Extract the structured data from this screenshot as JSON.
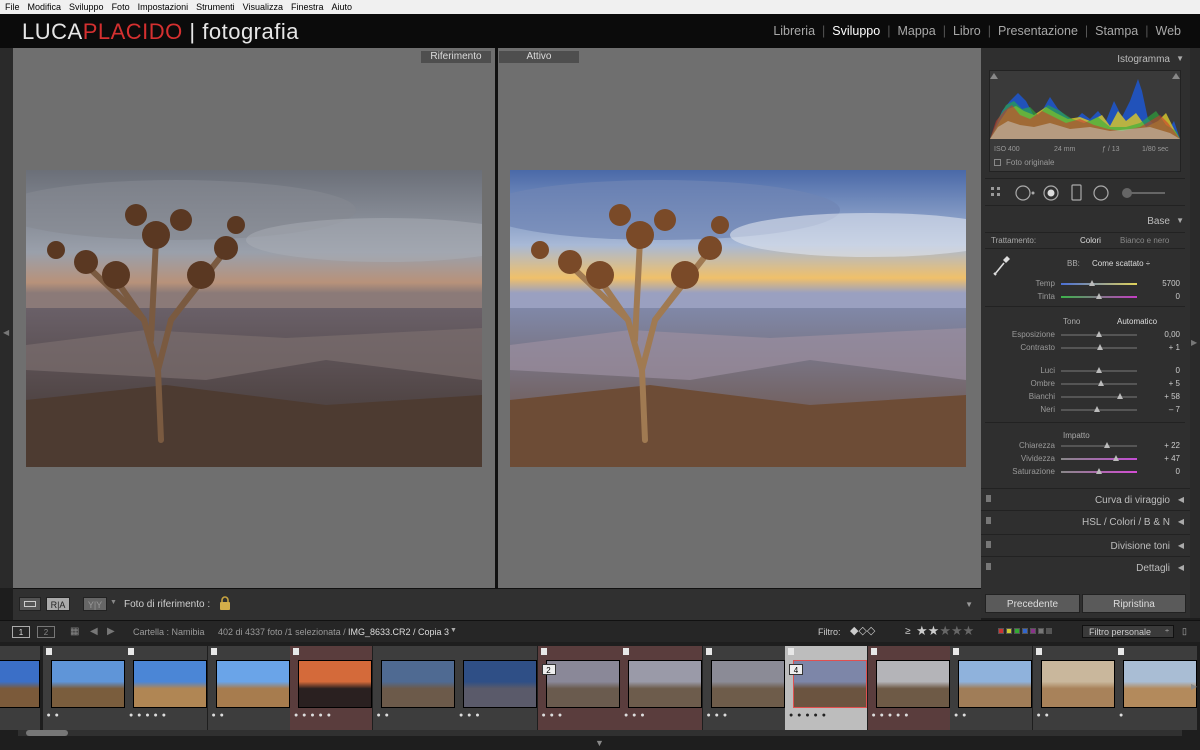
{
  "menu": [
    "File",
    "Modifica",
    "Sviluppo",
    "Foto",
    "Impostazioni",
    "Strumenti",
    "Visualizza",
    "Finestra",
    "Aiuto"
  ],
  "logo": {
    "part1": "LUCA",
    "part2": "PLACIDO",
    "sep": "|",
    "part3": "fotografia"
  },
  "modules": [
    {
      "label": "Libreria",
      "active": false
    },
    {
      "label": "Sviluppo",
      "active": true
    },
    {
      "label": "Mappa",
      "active": false
    },
    {
      "label": "Libro",
      "active": false
    },
    {
      "label": "Presentazione",
      "active": false
    },
    {
      "label": "Stampa",
      "active": false
    },
    {
      "label": "Web",
      "active": false
    }
  ],
  "compare": {
    "ref_label": "Riferimento",
    "active_label": "Attivo"
  },
  "toolbar": {
    "ref_photo_label": "Foto di riferimento :",
    "btn_view1": "R|A",
    "btn_view2": "Y|Y"
  },
  "panel": {
    "histogram_title": "Istogramma",
    "exif": {
      "iso": "ISO 400",
      "focal": "24 mm",
      "aperture": "ƒ / 13",
      "shutter": "1/80 sec"
    },
    "original_label": "Foto originale",
    "base_title": "Base",
    "treatment_label": "Trattamento:",
    "treatment_color": "Colori",
    "treatment_bw": "Bianco e nero",
    "wb_label": "BB:",
    "wb_value": "Come scattato ÷",
    "tone_label": "Tono",
    "auto_label": "Automatico",
    "presence_label": "Impatto",
    "sliders": [
      {
        "label": "Temp",
        "value": "5700",
        "pos": 0.41
      },
      {
        "label": "Tinta",
        "value": "0",
        "pos": 0.5
      },
      {
        "label": "Esposizione",
        "value": "0,00",
        "pos": 0.5
      },
      {
        "label": "Contrasto",
        "value": "+ 1",
        "pos": 0.51
      },
      {
        "label": "Luci",
        "value": "0",
        "pos": 0.5
      },
      {
        "label": "Ombre",
        "value": "+ 5",
        "pos": 0.53
      },
      {
        "label": "Bianchi",
        "value": "+ 58",
        "pos": 0.78
      },
      {
        "label": "Neri",
        "value": "– 7",
        "pos": 0.47
      },
      {
        "label": "Chiarezza",
        "value": "+ 22",
        "pos": 0.61
      },
      {
        "label": "Vividezza",
        "value": "+ 47",
        "pos": 0.72
      },
      {
        "label": "Saturazione",
        "value": "0",
        "pos": 0.5
      }
    ],
    "collapsed_sections": [
      "Curva di viraggio",
      "HSL  /  Colori  /  B & N",
      "Divisione toni",
      "Dettagli"
    ],
    "prev_button": "Precedente",
    "reset_button": "Ripristina"
  },
  "filmstrip_bar": {
    "page1": "1",
    "page2": "2",
    "folder": "Cartella : Namibia",
    "count": "402 di 4337 foto /1 selezionata /",
    "filename": "IMG_8633.CR2 / Copia 3",
    "filter_label": "Filtro:",
    "rating_op": "≥",
    "filter_preset": "Filtro personale"
  },
  "film": [
    {
      "stars": "",
      "bg": "#3d3d3d",
      "flag": true,
      "sky": "#3b6fc7",
      "ground": "#7b5a3a",
      "num": ""
    },
    {
      "stars": "● ●",
      "bg": "#3d3d3d",
      "flag": true,
      "sky": "#5f95d8",
      "ground": "#7a5d3d",
      "num": ""
    },
    {
      "stars": "● ● ● ● ●",
      "bg": "#3d3d3d",
      "flag": true,
      "sky": "#4b86d6",
      "ground": "#b08654",
      "num": ""
    },
    {
      "stars": "● ●",
      "bg": "#3d3d3d",
      "flag": true,
      "sky": "#6aa4e8",
      "ground": "#a77c4e",
      "num": ""
    },
    {
      "stars": "● ● ● ● ●",
      "bg": "#5a3d3d",
      "flag": true,
      "sky": "#d46a3a",
      "ground": "#2a2020",
      "num": ""
    },
    {
      "stars": "● ●",
      "bg": "#3d3d3d",
      "flag": false,
      "sky": "#4f6a92",
      "ground": "#6c5a4a",
      "num": ""
    },
    {
      "stars": "● ● ●",
      "bg": "#3d3d3d",
      "flag": false,
      "sky": "#2f4f86",
      "ground": "#5a5a6a",
      "num": ""
    },
    {
      "stars": "● ● ●",
      "bg": "#5a3d3d",
      "flag": true,
      "sky": "#8a8898",
      "ground": "#6a5b4e",
      "num": "2"
    },
    {
      "stars": "● ● ●",
      "bg": "#5a3d3d",
      "flag": true,
      "sky": "#9a9aa8",
      "ground": "#6d5c4c",
      "num": ""
    },
    {
      "stars": "● ● ●",
      "bg": "#3d3d3d",
      "flag": true,
      "sky": "#8b8b96",
      "ground": "#6e5c4a",
      "num": ""
    },
    {
      "stars": "● ● ● ● ●",
      "bg": "#bdbdbd",
      "flag": true,
      "sky": "#7d86a8",
      "ground": "#6b5440",
      "num": "4"
    },
    {
      "stars": "● ● ● ● ●",
      "bg": "#5a3d3d",
      "flag": true,
      "sky": "#b4b4b8",
      "ground": "#6e5a46",
      "num": ""
    },
    {
      "stars": "● ●",
      "bg": "#3d3d3d",
      "flag": true,
      "sky": "#8fb2dc",
      "ground": "#a07d58",
      "num": ""
    },
    {
      "stars": "● ●",
      "bg": "#3d3d3d",
      "flag": true,
      "sky": "#c9b79c",
      "ground": "#a8825a",
      "num": ""
    },
    {
      "stars": "●",
      "bg": "#3d3d3d",
      "flag": true,
      "sky": "#a9bdd4",
      "ground": "#b38a5c",
      "num": ""
    }
  ]
}
